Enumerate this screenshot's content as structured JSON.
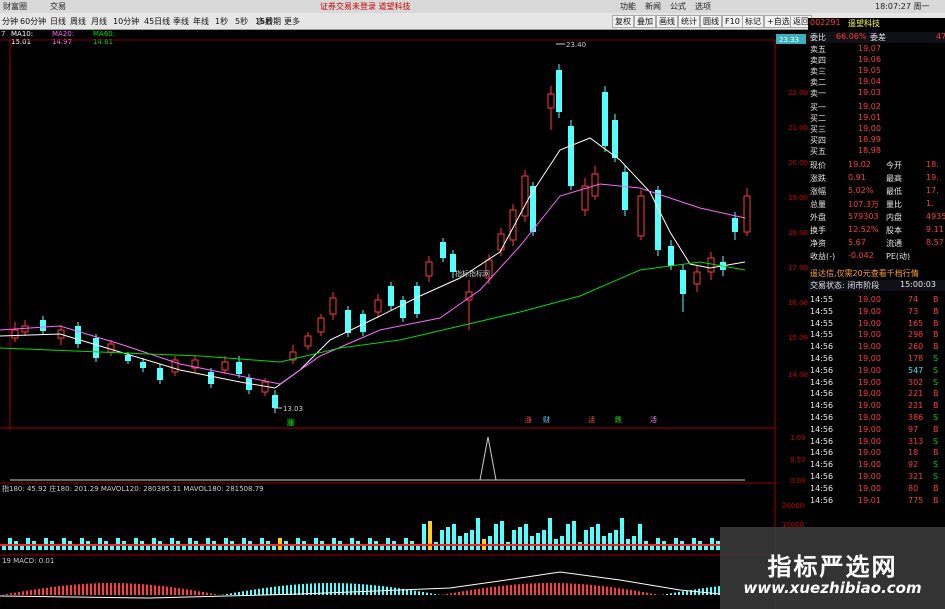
{
  "titlebar": {
    "left_items": [
      "财富圈",
      "交易"
    ],
    "center_text": "证券交易未登录 道望科技",
    "right_items": [
      "功能",
      "新闻",
      "公式",
      "选项"
    ],
    "clock": "18:07:27 周一"
  },
  "toolbar": {
    "periods": [
      "分钟",
      "60分钟",
      "日线",
      "周线",
      "月线",
      "10分钟",
      "45日线",
      "季线",
      "年线",
      "1秒",
      "5秒",
      "15秒",
      "多周期",
      "更多"
    ],
    "right_buttons": [
      "复权",
      "叠加",
      "画线",
      "统计",
      "圆线",
      "F10",
      "标记",
      "+自选",
      "返回"
    ]
  },
  "ma_legend": {
    "prefix": "7",
    "ma10": "MA10: 15.01",
    "ma20": "MA20: 14.97",
    "ma60": "MA60: 14.81"
  },
  "chart_labels": {
    "high_marker": "23.40",
    "low_marker": "13.03",
    "mid_label": "指标指标网",
    "axis_prices": [
      "23.33",
      "22.00",
      "21.00",
      "20.00",
      "19.00",
      "18.00",
      "17.00",
      "16.00",
      "15.00",
      "14.00"
    ],
    "signal_chars": [
      "涨",
      "财",
      "活",
      "跌",
      "活",
      "跌"
    ],
    "low_signal": "涨",
    "sub1_axis": [
      "1.00",
      "0.50",
      "0.00"
    ],
    "vol_legend": "指180: 45.92 庄180: 201.29  MAVOL120: 280385.31  MAVOL180: 281508.79",
    "vol_axis": [
      "20000",
      "10000"
    ],
    "macd_legend": "19  MACD: 0.01"
  },
  "right_panel": {
    "code": "002291",
    "name": "遥望科技",
    "committee": {
      "label": "委比",
      "value": "66.06%",
      "label2": "委差",
      "value2": "47"
    },
    "asks": [
      {
        "label": "卖五",
        "price": "19.07"
      },
      {
        "label": "卖四",
        "price": "19.06"
      },
      {
        "label": "卖三",
        "price": "19.05"
      },
      {
        "label": "卖二",
        "price": "19.04"
      },
      {
        "label": "卖一",
        "price": "19.03"
      }
    ],
    "bids": [
      {
        "label": "买一",
        "price": "19.02"
      },
      {
        "label": "买二",
        "price": "19.01"
      },
      {
        "label": "买三",
        "price": "19.00"
      },
      {
        "label": "买四",
        "price": "18.99"
      },
      {
        "label": "买五",
        "price": "18.98"
      }
    ],
    "quote": [
      {
        "l1": "现价",
        "v1": "19.02",
        "l2": "今开",
        "v2": "18."
      },
      {
        "l1": "涨跌",
        "v1": "0.91",
        "l2": "最高",
        "v2": "19."
      },
      {
        "l1": "涨幅",
        "v1": "5.02%",
        "l2": "最低",
        "v2": "17."
      },
      {
        "l1": "总量",
        "v1": "107.3万",
        "l2": "量比",
        "v2": "1."
      },
      {
        "l1": "外盘",
        "v1": "579303",
        "l2": "内盘",
        "v2": "4935"
      },
      {
        "l1": "换手",
        "v1": "12.52%",
        "l2": "股本",
        "v2": "9.11"
      },
      {
        "l1": "净资",
        "v1": "5.67",
        "l2": "流通",
        "v2": "8.57"
      },
      {
        "l1": "收益(-)",
        "v1": "-0.042",
        "l2": "PE(动)",
        "v2": ""
      }
    ],
    "ad_text": "遥达信,仅需20元查看千档行情",
    "trade_status": "交易状态: 闭市阶段",
    "trade_time": "15:00:03",
    "ticks": [
      {
        "t": "14:55",
        "p": "19.00",
        "v": "74",
        "s": "B"
      },
      {
        "t": "14:55",
        "p": "19.00",
        "v": "73",
        "s": "B"
      },
      {
        "t": "14:55",
        "p": "19.00",
        "v": "165",
        "s": "B"
      },
      {
        "t": "14:55",
        "p": "19.00",
        "v": "298",
        "s": "B"
      },
      {
        "t": "14:56",
        "p": "19.00",
        "v": "260",
        "s": "B"
      },
      {
        "t": "14:56",
        "p": "19.00",
        "v": "178",
        "s": "S"
      },
      {
        "t": "14:56",
        "p": "19.00",
        "v": "547",
        "s": "S"
      },
      {
        "t": "14:56",
        "p": "19.00",
        "v": "302",
        "s": "S"
      },
      {
        "t": "14:56",
        "p": "19.00",
        "v": "221",
        "s": "B"
      },
      {
        "t": "14:56",
        "p": "19.00",
        "v": "221",
        "s": "B"
      },
      {
        "t": "14:56",
        "p": "19.00",
        "v": "386",
        "s": "S"
      },
      {
        "t": "14:56",
        "p": "19.00",
        "v": "97",
        "s": "B"
      },
      {
        "t": "14:56",
        "p": "19.00",
        "v": "313",
        "s": "S"
      },
      {
        "t": "14:56",
        "p": "19.00",
        "v": "18",
        "s": "B"
      },
      {
        "t": "14:56",
        "p": "19.00",
        "v": "92",
        "s": "S"
      },
      {
        "t": "14:56",
        "p": "19.00",
        "v": "321",
        "s": "S"
      },
      {
        "t": "14:56",
        "p": "19.00",
        "v": "80",
        "s": "B"
      },
      {
        "t": "14:56",
        "p": "19.01",
        "v": "775",
        "s": "B"
      }
    ]
  },
  "watermark": {
    "cn": "指标严选网",
    "url": "www.xuezhibiao.com"
  },
  "colors": {
    "up": "#ff3b3b",
    "down": "#54ffff",
    "ma10": "#ffffff",
    "ma20": "#ff66ff",
    "ma60": "#00dd00"
  }
}
